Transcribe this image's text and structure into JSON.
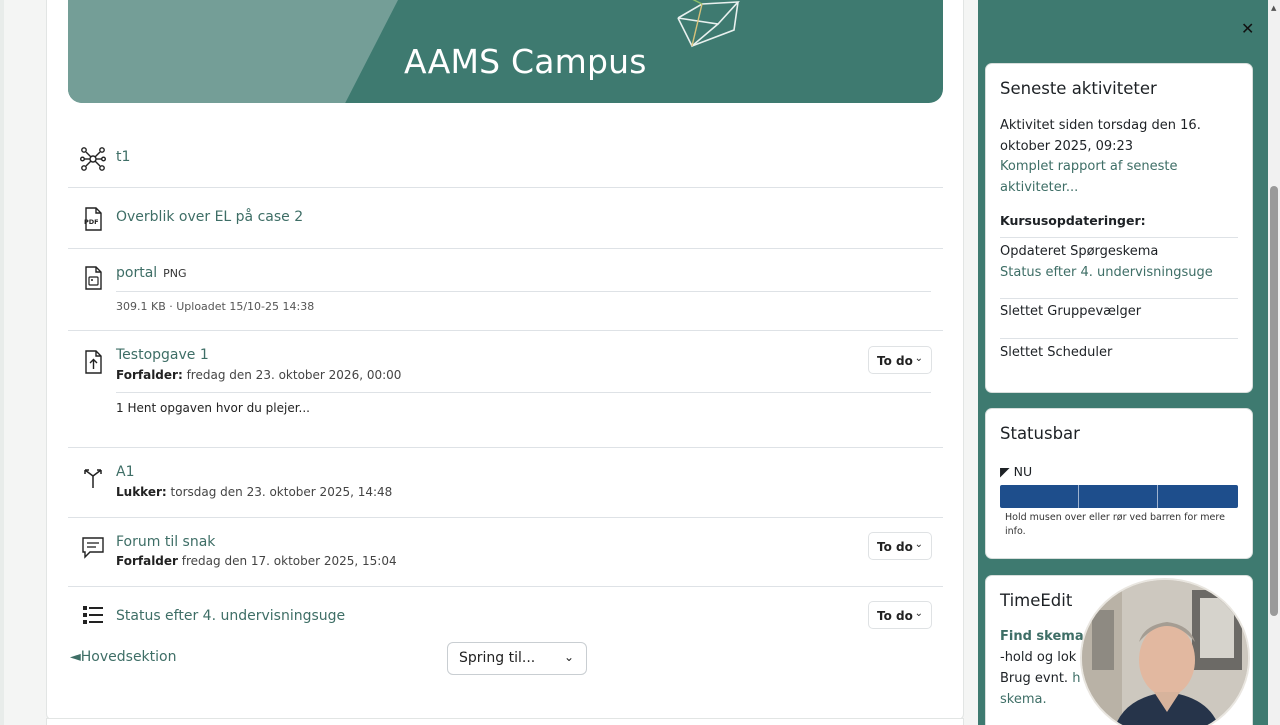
{
  "banner": {
    "title": "AAMS Campus"
  },
  "items": [
    {
      "label": "t1",
      "icon": "network-icon"
    },
    {
      "label": "Overblik over EL på case 2",
      "icon": "pdf-icon"
    },
    {
      "label": "portal",
      "badge": "PNG",
      "meta": "309.1 KB · Uploadet 15/10-25 14:38",
      "icon": "image-file-icon"
    },
    {
      "label": "Testopgave 1",
      "meta_label": "Forfalder:",
      "meta_value": "fredag den 23. oktober 2026, 00:00",
      "description": "1 Hent opgaven hvor du plejer...",
      "todo": "To do",
      "icon": "upload-icon"
    },
    {
      "label": "A1",
      "meta_label": "Lukker:",
      "meta_value": "torsdag den 23. oktober 2025, 14:48",
      "icon": "choice-icon"
    },
    {
      "label": "Forum til snak",
      "meta_label": "Forfalder",
      "meta_value": "fredag den 17. oktober 2025, 15:04",
      "todo": "To do",
      "icon": "forum-icon"
    },
    {
      "label": "Status efter 4. undervisningsuge",
      "todo": "To do",
      "icon": "list-icon"
    }
  ],
  "footer": {
    "prev_link": "◄Hovedsektion",
    "jump_label": "Spring til..."
  },
  "drawer": {
    "recent": {
      "title": "Seneste aktiviteter",
      "since_line1": "Aktivitet siden torsdag den 16.",
      "since_line2": "oktober 2025, 09:23",
      "report_line1": "Komplet rapport af seneste",
      "report_line2": "aktiviteter...",
      "updates_heading": "Kursusopdateringer:",
      "updates": [
        {
          "text": "Opdateret Spørgeskema",
          "link": "Status efter 4. undervisningsuge"
        },
        {
          "text": "Slettet Gruppevælger"
        },
        {
          "text": "Slettet Scheduler"
        }
      ]
    },
    "statusbar": {
      "title": "Statusbar",
      "now": "NU",
      "hint_line1": "Hold musen over eller rør ved barren for mere",
      "hint_line2": "info."
    },
    "timeedit": {
      "title": "TimeEdit",
      "find_link": "Find skema",
      "line2": "-hold og lok",
      "line3a": "Brug evnt.",
      "line3b": "h",
      "line4": "skema."
    }
  },
  "colors": {
    "brand": "#3e7a70",
    "link": "#3e6e66",
    "bar": "#1e4e8c"
  }
}
